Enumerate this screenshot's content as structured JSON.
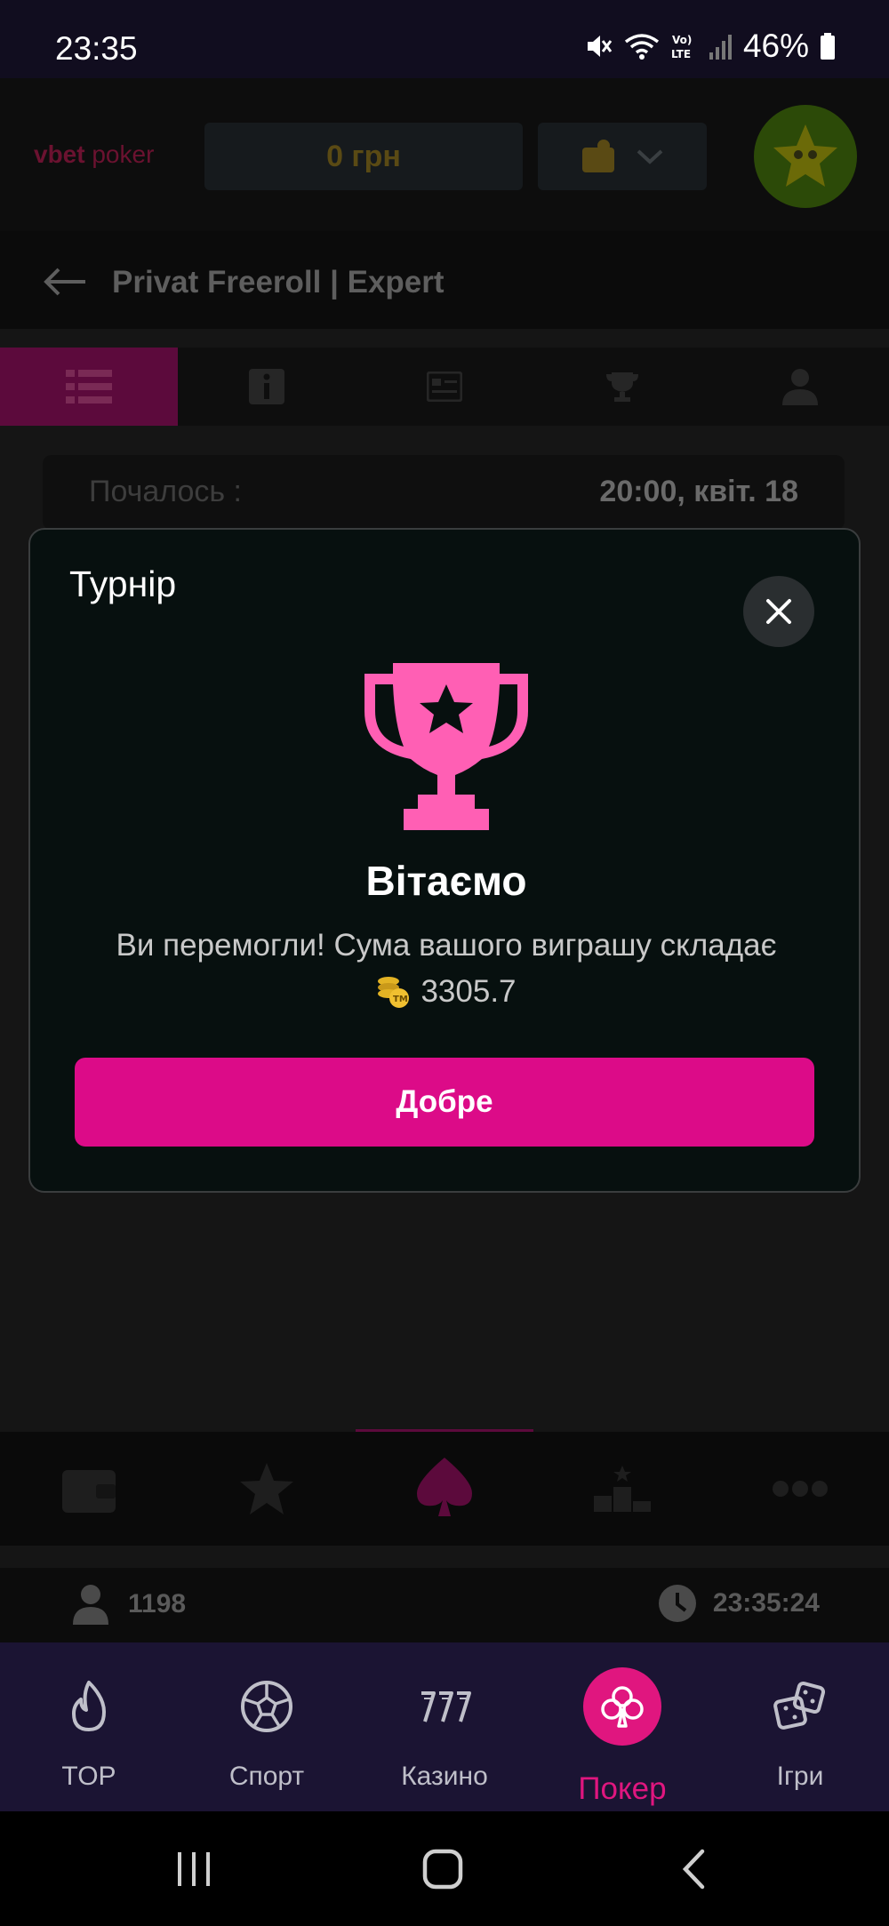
{
  "status_bar": {
    "time": "23:35",
    "battery_percent": "46%"
  },
  "header": {
    "brand_bold": "vbet",
    "brand_rest": " poker",
    "balance": "0 грн"
  },
  "page": {
    "title": "Privat Freeroll | Expert"
  },
  "tabs": [
    {
      "icon": "list-icon",
      "active": true
    },
    {
      "icon": "info-icon",
      "active": false
    },
    {
      "icon": "card-icon",
      "active": false
    },
    {
      "icon": "trophy-icon",
      "active": false
    },
    {
      "icon": "user-icon",
      "active": false
    }
  ],
  "info_row": {
    "label": "Почалось :",
    "value": "20:00, квіт. 18"
  },
  "modal": {
    "title": "Турнір",
    "heading": "Вітаємо",
    "message": "Ви перемогли! Сума вашого виграшу складає",
    "amount": "3305.7",
    "ok_label": "Добре"
  },
  "online_bar": {
    "players": "1198",
    "clock": "23:35:24"
  },
  "bottom_nav": {
    "items": [
      {
        "label": "TOP",
        "icon": "flame-icon"
      },
      {
        "label": "Спорт",
        "icon": "soccer-ball-icon"
      },
      {
        "label": "Казино",
        "icon": "slots-777-icon"
      },
      {
        "label": "Покер",
        "icon": "poker-club-icon",
        "active": true
      },
      {
        "label": "Ігри",
        "icon": "dice-icon"
      }
    ]
  },
  "colors": {
    "accent": "#dc0b88",
    "trophy": "#ff5fb4",
    "bottom_nav_bg": "#1b1433"
  }
}
